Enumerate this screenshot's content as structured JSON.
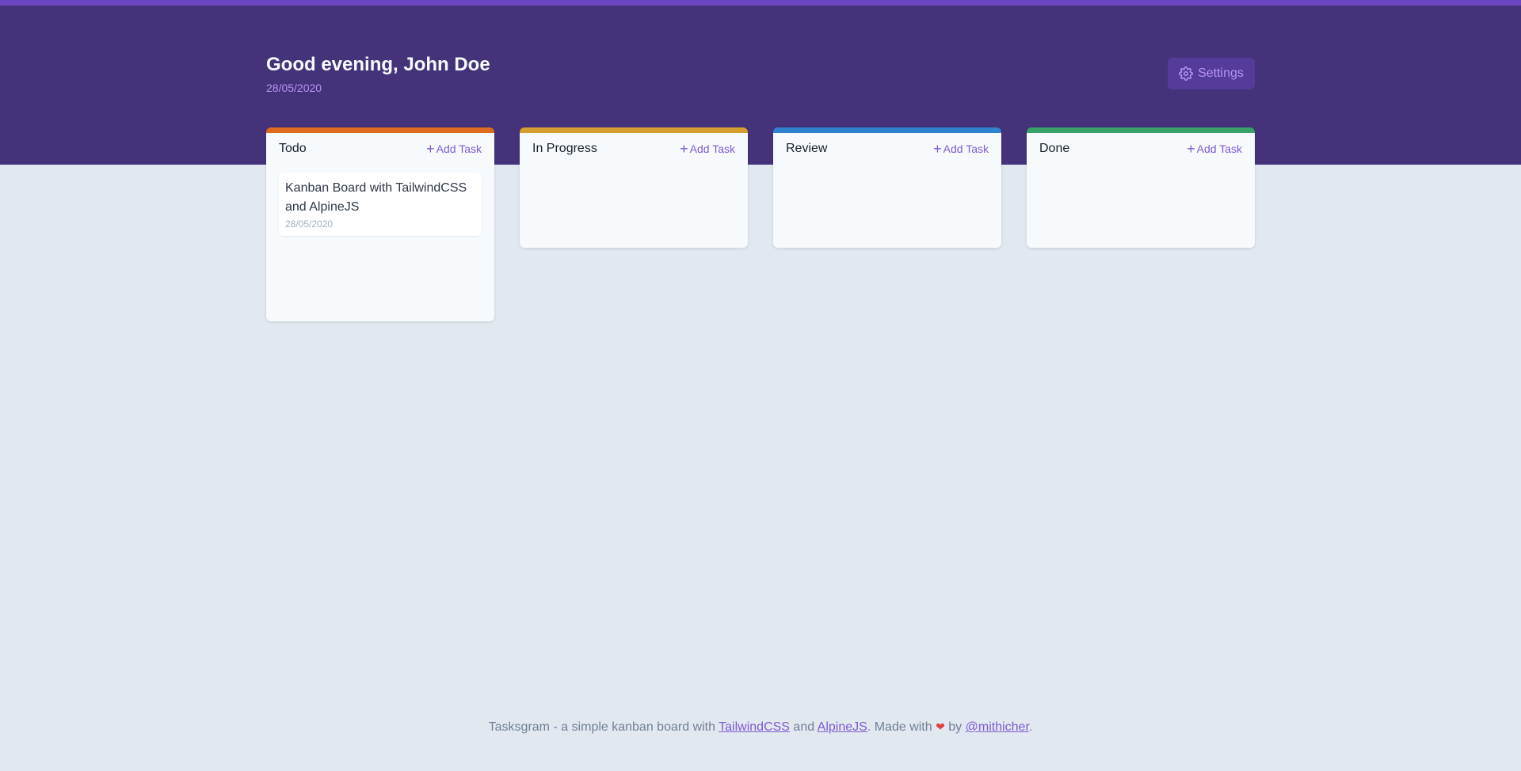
{
  "header": {
    "greeting": "Good evening, John Doe",
    "date": "28/05/2020",
    "settings_label": "Settings"
  },
  "columns": [
    {
      "title": "Todo",
      "add_label": "Add Task",
      "color": "#dd6b20",
      "tasks": [
        {
          "title": "Kanban Board with TailwindCSS and AlpineJS",
          "date": "28/05/2020"
        }
      ]
    },
    {
      "title": "In Progress",
      "add_label": "Add Task",
      "color": "#d69e2e",
      "tasks": []
    },
    {
      "title": "Review",
      "add_label": "Add Task",
      "color": "#3182ce",
      "tasks": []
    },
    {
      "title": "Done",
      "add_label": "Add Task",
      "color": "#38a169",
      "tasks": []
    }
  ],
  "footer": {
    "text_1": "Tasksgram - a simple kanban board with ",
    "link_1": "TailwindCSS",
    "text_2": " and ",
    "link_2": "AlpineJS",
    "text_3": ". Made with ",
    "text_4": " by ",
    "link_3": "@mithicher",
    "text_5": "."
  },
  "icons": {
    "settings": "gear-icon",
    "add": "plus-icon",
    "heart": "heart-icon"
  },
  "colors": {
    "brand_dark": "#44337a",
    "brand": "#6b46c1",
    "accent": "#805ad5"
  }
}
